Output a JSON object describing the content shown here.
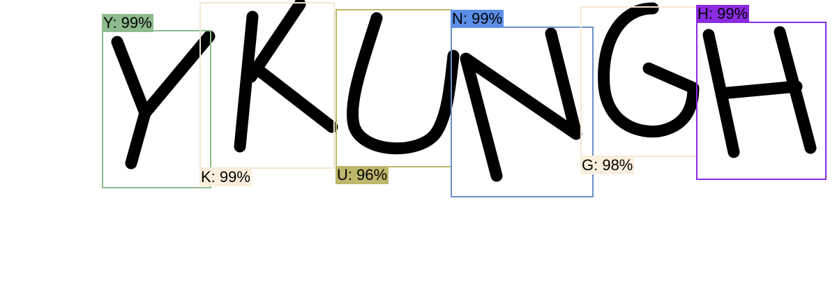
{
  "detections": [
    {
      "char": "Y",
      "label": "Y: 99%",
      "box_color": "#8fbc8f",
      "label_bg": "#8fbc8f"
    },
    {
      "char": "K",
      "label": "K: 99%",
      "box_color": "#f5e6d3",
      "label_bg": "#fbeedd"
    },
    {
      "char": "U",
      "label": "U: 96%",
      "box_color": "#bdb76b",
      "label_bg": "#bdb76b"
    },
    {
      "char": "N",
      "label": "N: 99%",
      "box_color": "#6a8fc8",
      "label_bg": "#5b8fe6"
    },
    {
      "char": "G",
      "label": "G: 98%",
      "box_color": "#f5e6d3",
      "label_bg": "#fbeedd"
    },
    {
      "char": "H",
      "label": "H: 99%",
      "box_color": "#8a2be2",
      "label_bg": "#8a2be2"
    }
  ]
}
